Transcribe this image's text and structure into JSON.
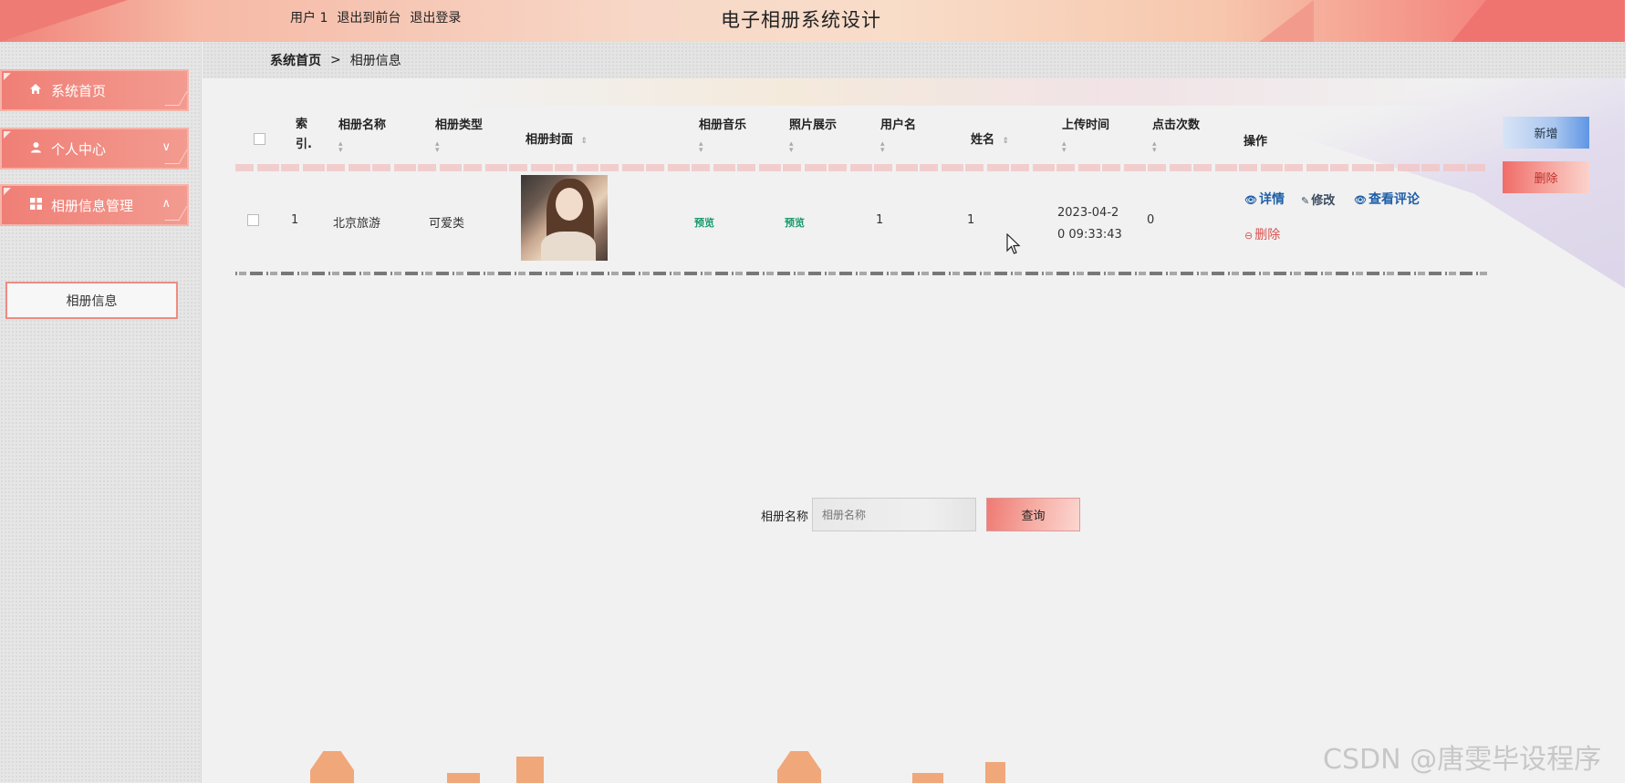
{
  "header": {
    "user_label": "用户 1",
    "back_to_front": "退出到前台",
    "logout": "退出登录",
    "title": "电子相册系统设计"
  },
  "sidebar": {
    "items": [
      {
        "label": "系统首页",
        "icon": "home-icon"
      },
      {
        "label": "个人中心",
        "icon": "user-icon",
        "arrow": "∨"
      },
      {
        "label": "相册信息管理",
        "icon": "grid-icon",
        "arrow": "∧"
      }
    ],
    "submenu": [
      {
        "label": "相册信息"
      }
    ]
  },
  "breadcrumb": {
    "home": "系统首页",
    "separator": ">",
    "current": "相册信息"
  },
  "table": {
    "headers": {
      "index": "索\n引.",
      "album_name": "相册名称",
      "album_type": "相册类型",
      "cover": "相册封面",
      "music": "相册音乐",
      "photos": "照片展示",
      "username": "用户名",
      "name": "姓名",
      "upload_time": "上传时间",
      "clicks": "点击次数",
      "actions": "操作"
    },
    "rows": [
      {
        "index": "1",
        "album_name": "北京旅游",
        "album_type": "可爱类",
        "music": "预览",
        "photos": "预览",
        "username": "1",
        "name": "1",
        "upload_time_line1": "2023-04-2",
        "upload_time_line2": "0 09:33:43",
        "clicks": "0"
      }
    ],
    "actions": {
      "detail": "详情",
      "edit": "修改",
      "comments": "查看评论",
      "delete": "删除"
    }
  },
  "buttons": {
    "add": "新增",
    "delete": "删除"
  },
  "search": {
    "label": "相册名称",
    "placeholder": "相册名称",
    "button": "查询"
  },
  "watermark": "CSDN @唐雯毕设程序",
  "colors": {
    "accent": "#ef7f76",
    "link": "#1f5fa8",
    "preview": "#1a9a6c",
    "danger": "#d9534f"
  }
}
